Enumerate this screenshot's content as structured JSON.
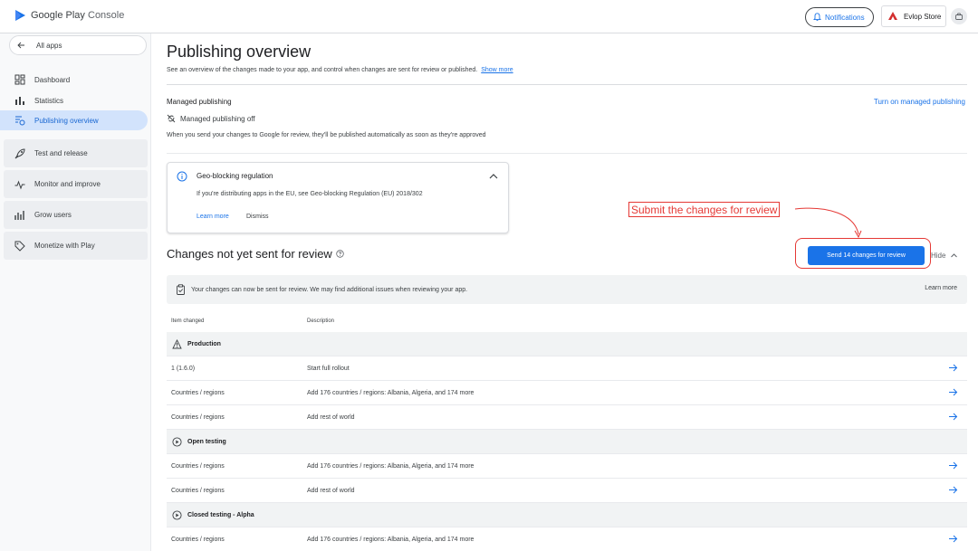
{
  "app": {
    "logo_label_1": "Google Play",
    "logo_label_2": "Console",
    "notifications_label": "Notifications",
    "store_name": "Evlop Store"
  },
  "sidebar": {
    "all_apps": "All apps",
    "items": [
      {
        "label": "Dashboard",
        "icon": "dashboard-icon"
      },
      {
        "label": "Statistics",
        "icon": "bar-chart-icon"
      },
      {
        "label": "Publishing overview",
        "icon": "publishing-icon",
        "active": true
      }
    ],
    "sections": [
      {
        "label": "Test and release",
        "icon": "rocket-icon"
      },
      {
        "label": "Monitor and improve",
        "icon": "pulse-icon"
      },
      {
        "label": "Grow users",
        "icon": "grow-icon"
      },
      {
        "label": "Monetize with Play",
        "icon": "tag-icon"
      }
    ]
  },
  "main": {
    "title": "Publishing overview",
    "subtitle": "See an overview of the changes made to your app, and control when changes are sent for review or published.",
    "show_more": "Show more",
    "managed": {
      "title": "Managed publishing",
      "turn_on": "Turn on managed publishing",
      "status": "Managed publishing off",
      "desc": "When you send your changes to Google for review, they'll be published automatically as soon as they're approved"
    },
    "geo": {
      "title": "Geo-blocking regulation",
      "desc": "If you're distributing apps in the EU, see Geo-blocking Regulation (EU) 2018/302",
      "learn_more": "Learn more",
      "dismiss": "Dismiss"
    },
    "annotation": "Submit the changes for review",
    "changes": {
      "title": "Changes not yet sent for review",
      "send_button": "Send 14 changes for review",
      "hide": "Hide",
      "notice": "Your changes can now be sent for review. We may find additional issues when reviewing your app.",
      "notice_learn": "Learn more",
      "col_item": "Item changed",
      "col_desc": "Description",
      "rows": [
        {
          "group": true,
          "label": "Production",
          "icon": "warning-icon"
        },
        {
          "item": "1 (1.6.0)",
          "desc": "Start full rollout"
        },
        {
          "item": "Countries / regions",
          "desc": "Add 176 countries / regions: Albania, Algeria, and 174 more"
        },
        {
          "item": "Countries / regions",
          "desc": "Add rest of world"
        },
        {
          "group": true,
          "label": "Open testing",
          "icon": "play-circle-icon"
        },
        {
          "item": "Countries / regions",
          "desc": "Add 176 countries / regions: Albania, Algeria, and 174 more"
        },
        {
          "item": "Countries / regions",
          "desc": "Add rest of world"
        },
        {
          "group": true,
          "label": "Closed testing - Alpha",
          "icon": "play-circle-icon"
        },
        {
          "item": "Countries / regions",
          "desc": "Add 176 countries / regions: Albania, Algeria, and 174 more"
        }
      ]
    }
  },
  "colors": {
    "accent": "#1a73e8",
    "annotation": "#e53935",
    "active_nav": "#d2e3fc"
  }
}
